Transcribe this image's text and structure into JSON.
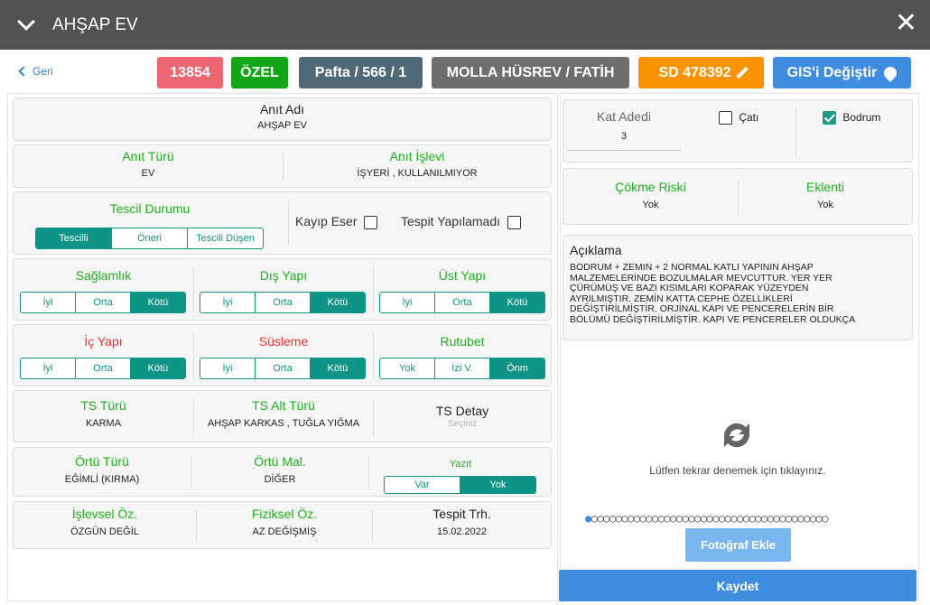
{
  "window": {
    "title": "AHŞAP EV"
  },
  "nav": {
    "back_label": "Geri"
  },
  "badges": {
    "id": "13854",
    "type": "ÖZEL",
    "pafta": "Pafta / 566 / 1",
    "location": "MOLLA HÜSREV / FATİH",
    "sd": "SD 478392",
    "gis": "GIS'i Değiştir"
  },
  "form": {
    "anit_adi": {
      "label": "Anıt Adı",
      "value": "AHŞAP EV"
    },
    "anit_turu": {
      "label": "Anıt Türü",
      "value": "EV"
    },
    "anit_islevi": {
      "label": "Anıt İşlevi",
      "value": "İŞYERİ , KULLANILMIYOR"
    },
    "tescil": {
      "label": "Tescil Durumu",
      "options": [
        "Tescilli",
        "Öneri",
        "Tescili Düşen"
      ],
      "kayip_eser": "Kayıp Eser",
      "tespit_yapilamadi": "Tespit Yapılamadı"
    },
    "saglamlik": {
      "label": "Sağlamlık",
      "options": [
        "İyi",
        "Orta",
        "Kötü"
      ]
    },
    "dis_yapi": {
      "label": "Dış Yapı",
      "options": [
        "İyi",
        "Orta",
        "Kötü"
      ]
    },
    "ust_yapi": {
      "label": "Üst Yapı",
      "options": [
        "İyi",
        "Orta",
        "Kötü"
      ]
    },
    "ic_yapi": {
      "label": "İç Yapı",
      "options": [
        "İyi",
        "Orta",
        "Kötü"
      ]
    },
    "susleme": {
      "label": "Süsleme",
      "options": [
        "İyi",
        "Orta",
        "Kötü"
      ]
    },
    "rutubet": {
      "label": "Rutubet",
      "options": [
        "Yok",
        "İzi V.",
        "Önm"
      ]
    },
    "ts_turu": {
      "label": "TS Türü",
      "value": "KARMA"
    },
    "ts_alt_turu": {
      "label": "TS Alt Türü",
      "value": "AHŞAP KARKAS , TUĞLA YIĞMA"
    },
    "ts_detay": {
      "label": "TS Detay",
      "placeholder": "Seçiniz"
    },
    "ortu_turu": {
      "label": "Örtü Türü",
      "value": "EĞİMLİ (KIRMA)"
    },
    "ortu_mal": {
      "label": "Örtü Mal.",
      "value": "DİĞER"
    },
    "yazit": {
      "label": "Yazıt",
      "options": [
        "Var",
        "Yok"
      ]
    },
    "islevsel_oz": {
      "label": "İşlevsel Öz.",
      "value": "ÖZGÜN DEĞİL"
    },
    "fiziksel_oz": {
      "label": "Fiziksel Öz.",
      "value": "AZ DEĞİŞMİŞ"
    },
    "tespit_trh": {
      "label": "Tespit Trh.",
      "value": "15.02.2022"
    }
  },
  "right": {
    "kat_adedi": {
      "label": "Kat Adedi",
      "value": "3"
    },
    "cati": "Çatı",
    "bodrum": "Bodrum",
    "cokme_riski": {
      "label": "Çökme Riski",
      "value": "Yok"
    },
    "eklenti": {
      "label": "Eklenti",
      "value": "Yok"
    },
    "aciklama": {
      "label": "Açıklama",
      "lines": [
        "BODRUM + ZEMİN + 2 NORMAL KATLI YAPININ AHŞAP",
        "MALZEMELERİNDE BOZULMALAR MEVCUTTUR. YER YER",
        "ÇÜRÜMÜŞ VE BAZI KISIMLARI KOPARAK YÜZEYDEN",
        "AYRILMIŞTIR. ZEMİN KATTA CEPHE ÖZELLİKLERİ",
        "DEĞİŞTİRİLMİŞTİR. ORJİNAL KAPI VE PENCERELERİN BİR",
        "BÖLÜMÜ DEĞİŞTİRİLMİŞTİR. KAPI VE PENCERELER OLDUKÇA"
      ]
    },
    "retry_text": "Lütfen tekrar denemek için tıklayınız.",
    "pager_dots": "○○○○○○○○○○○○○○○○○○○○○○○○○○○○○○○○○○○○○○○",
    "photo_button": "Fotoğraf Ekle",
    "save_button": "Kaydet"
  },
  "colors": {
    "accent_teal": "#0e9485",
    "label_green": "#1db11d",
    "label_red": "#f03030",
    "brand_blue": "#3f8de1"
  },
  "icons": [
    "chevron-down-icon",
    "close-icon",
    "chevron-left-icon",
    "pencil-icon",
    "map-pin-icon",
    "refresh-icon",
    "checkbox-icon"
  ]
}
